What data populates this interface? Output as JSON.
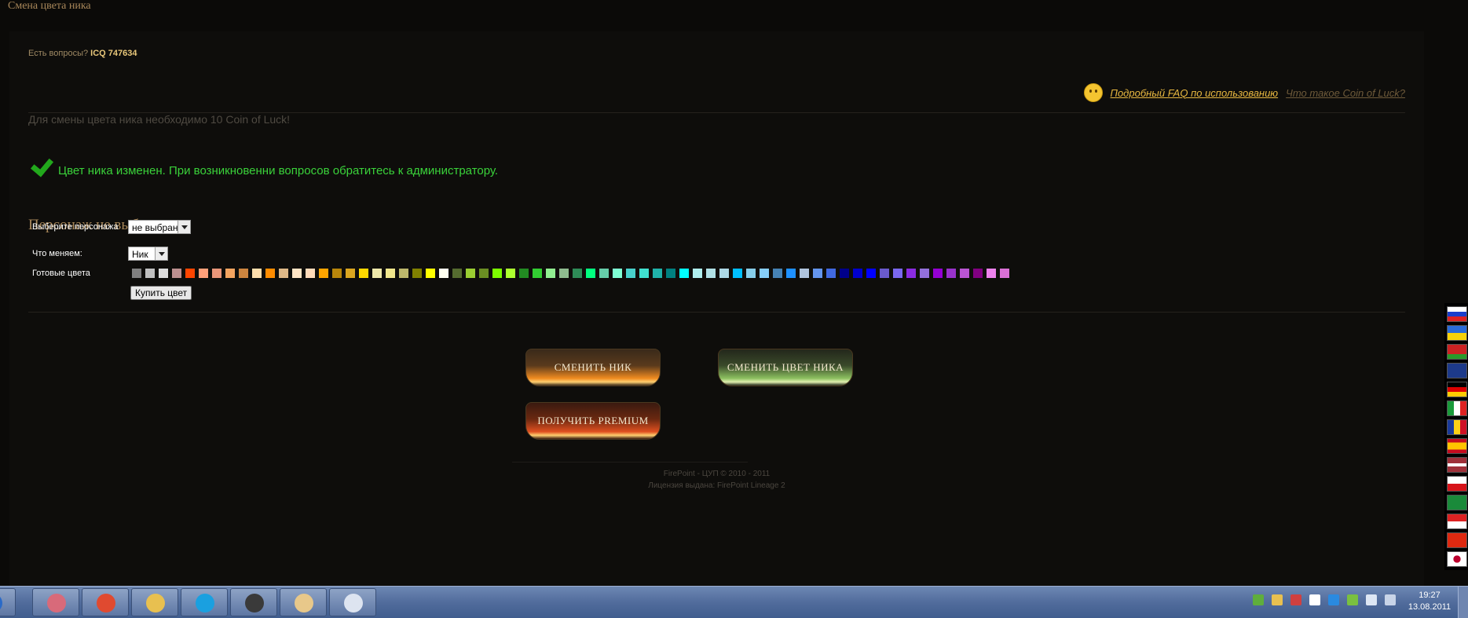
{
  "window": {
    "title": "Смена цвета ника"
  },
  "header": {
    "icq_prefix": "Есть вопросы?",
    "icq_number": "ICQ 747634"
  },
  "faq": {
    "faq_link": "Подробный FAQ по использованию",
    "coin_link": "Что такое Coin of Luck?"
  },
  "notice": {
    "coin_requirement": "Для смены цвета ника необходимо 10 Coin of Luck!"
  },
  "status": {
    "success_message": "Цвет ника изменен. При возникновенни вопросов обратитесь к администратору."
  },
  "character": {
    "heading": "Персонаж не выбран"
  },
  "form": {
    "character_label": "Выберите персонажа",
    "character_value": "не выбран",
    "change_label": "Что меняем:",
    "change_value": "Ник",
    "colors_label": "Готовые цвета",
    "buy_button": "Купить цвет"
  },
  "swatch_colors": [
    "#808080",
    "#c0c0c0",
    "#dcdcdc",
    "#bc8f8f",
    "#ff4500",
    "#ffa07a",
    "#e9967a",
    "#f4a460",
    "#cd853f",
    "#ffdead",
    "#ff8c00",
    "#deb887",
    "#ffe4c4",
    "#ffdab9",
    "#ffa500",
    "#b8860b",
    "#daa520",
    "#ffd700",
    "#eee8aa",
    "#f0e68c",
    "#bdb76b",
    "#808000",
    "#ffff00",
    "#fffff0",
    "#556b2f",
    "#9acd32",
    "#6b8e23",
    "#7cfc00",
    "#adff2f",
    "#228b22",
    "#32cd32",
    "#90ee90",
    "#8fbc8f",
    "#2e8b57",
    "#00ff7f",
    "#66cdaa",
    "#7fffd4",
    "#48d1cc",
    "#40e0d0",
    "#20b2aa",
    "#008080",
    "#00ffff",
    "#afeeee",
    "#b0e0e6",
    "#add8e6",
    "#00bfff",
    "#87ceeb",
    "#87cefa",
    "#4682b4",
    "#1e90ff",
    "#b0c4de",
    "#6495ed",
    "#4169e1",
    "#00008b",
    "#0000cd",
    "#0000ff",
    "#6a5acd",
    "#7b68ee",
    "#8a2be2",
    "#9370db",
    "#9400d3",
    "#9932cc",
    "#ba55d3",
    "#800080",
    "#ee82ee",
    "#da70d6"
  ],
  "actions": {
    "change_nick": "СМЕНИТЬ НИК",
    "change_nick_color": "СМЕНИТЬ ЦВЕТ НИКА",
    "get_premium": "ПОЛУЧИТЬ PREMIUM"
  },
  "footer": {
    "copyright": "FirePoint - ЦУП © 2010 - 2011",
    "license": "Лицензия выдана: FirePoint Lineage 2"
  },
  "language_flags": [
    "ru",
    "ua",
    "by",
    "en",
    "de",
    "it",
    "ro",
    "es",
    "lv",
    "cz",
    "ar",
    "id",
    "cn",
    "jp"
  ],
  "taskbar": {
    "apps": [
      "start-icon",
      "paint-icon",
      "chrome-icon",
      "explorer-icon",
      "skype-icon",
      "headset-icon",
      "game-avatar-icon",
      "document-icon"
    ],
    "clock_time": "19:27",
    "clock_date": "13.08.2011"
  }
}
